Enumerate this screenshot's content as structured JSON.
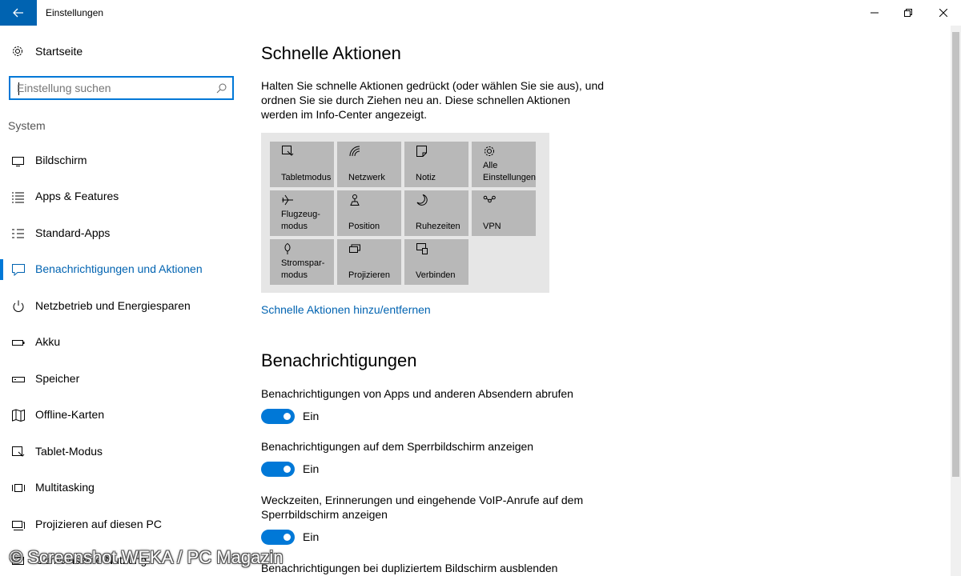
{
  "window": {
    "title": "Einstellungen",
    "accent": "#0078d7"
  },
  "sidebar": {
    "home_label": "Startseite",
    "search_placeholder": "Einstellung suchen",
    "section": "System",
    "items": [
      {
        "label": "Bildschirm",
        "icon": "monitor-icon"
      },
      {
        "label": "Apps & Features",
        "icon": "list-icon"
      },
      {
        "label": "Standard-Apps",
        "icon": "default-apps-icon"
      },
      {
        "label": "Benachrichtigungen und Aktionen",
        "icon": "notification-icon",
        "active": true
      },
      {
        "label": "Netzbetrieb und Energiesparen",
        "icon": "power-icon"
      },
      {
        "label": "Akku",
        "icon": "battery-icon"
      },
      {
        "label": "Speicher",
        "icon": "storage-icon"
      },
      {
        "label": "Offline-Karten",
        "icon": "map-icon"
      },
      {
        "label": "Tablet-Modus",
        "icon": "tablet-icon"
      },
      {
        "label": "Multitasking",
        "icon": "multitasking-icon"
      },
      {
        "label": "Projizieren auf diesen PC",
        "icon": "project-icon"
      },
      {
        "label": "Gemeinsame Nutzung",
        "icon": "share-icon"
      }
    ]
  },
  "main": {
    "quick_actions": {
      "title": "Schnelle Aktionen",
      "description": "Halten Sie schnelle Aktionen gedrückt (oder wählen Sie sie aus), und ordnen Sie sie durch Ziehen neu an. Diese schnellen Aktionen werden im Info-Center angezeigt.",
      "tiles": [
        {
          "label": "Tabletmodus",
          "icon": "tablet-mode-icon"
        },
        {
          "label": "Netzwerk",
          "icon": "network-icon"
        },
        {
          "label": "Notiz",
          "icon": "note-icon"
        },
        {
          "label": "Alle Einstellungen",
          "icon": "gear-icon"
        },
        {
          "label": "Flugzeug-modus",
          "icon": "airplane-icon"
        },
        {
          "label": "Position",
          "icon": "location-icon"
        },
        {
          "label": "Ruhezeiten",
          "icon": "moon-icon"
        },
        {
          "label": "VPN",
          "icon": "vpn-icon"
        },
        {
          "label": "Stromspar-modus",
          "icon": "battery-saver-icon"
        },
        {
          "label": "Projizieren",
          "icon": "project-icon"
        },
        {
          "label": "Verbinden",
          "icon": "connect-icon"
        }
      ],
      "link": "Schnelle Aktionen hinzu/entfernen"
    },
    "notifications": {
      "title": "Benachrichtigungen",
      "settings": [
        {
          "label": "Benachrichtigungen von Apps und anderen Absendern abrufen",
          "state": "Ein"
        },
        {
          "label": "Benachrichtigungen auf dem Sperrbildschirm anzeigen",
          "state": "Ein"
        },
        {
          "label": "Weckzeiten, Erinnerungen und eingehende VoIP-Anrufe auf dem Sperrbildschirm anzeigen",
          "state": "Ein"
        },
        {
          "label": "Benachrichtigungen bei dupliziertem Bildschirm ausblenden"
        }
      ]
    }
  },
  "watermark": "© Screenshot WEKA / PC Magazin"
}
